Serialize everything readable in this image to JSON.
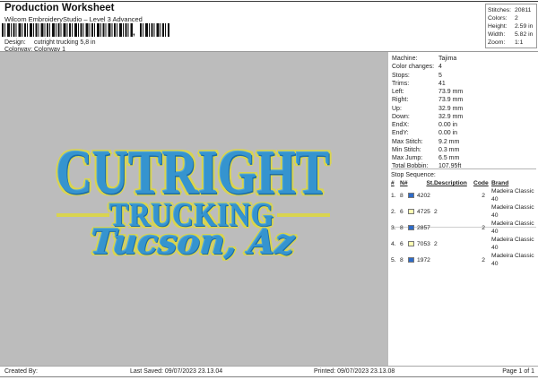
{
  "header": {
    "title": "Production Worksheet",
    "subtitle": "Wilcom EmbroideryStudio – Level 3 Advanced",
    "barcode_separator": ",",
    "design_label": "Design:",
    "design_value": "cutright trucking 5,8 in",
    "colorway_label": "Colorway:",
    "colorway_value": "Colorway 1"
  },
  "summary": {
    "rows": [
      {
        "label": "Stitches:",
        "value": "20811"
      },
      {
        "label": "Colors:",
        "value": "2"
      },
      {
        "label": "Height:",
        "value": "2.59 in"
      },
      {
        "label": "Width:",
        "value": "5.82 in"
      },
      {
        "label": "Zoom:",
        "value": "1:1"
      }
    ]
  },
  "machine_info": {
    "rows": [
      {
        "label": "Machine:",
        "value": "Tajima"
      },
      {
        "label": "Color changes:",
        "value": "4"
      },
      {
        "label": "Stops:",
        "value": "5"
      },
      {
        "label": "Trims:",
        "value": "41"
      },
      {
        "label": "Left:",
        "value": "73.9 mm"
      },
      {
        "label": "Right:",
        "value": "73.9 mm"
      },
      {
        "label": "Up:",
        "value": "32.9 mm"
      },
      {
        "label": "Down:",
        "value": "32.9 mm"
      },
      {
        "label": "EndX:",
        "value": "0.00 in"
      },
      {
        "label": "EndY:",
        "value": "0.00 in"
      },
      {
        "label": "Max Stitch:",
        "value": "9.2 mm"
      },
      {
        "label": "Min Stitch:",
        "value": "0.3 mm"
      },
      {
        "label": "Max Jump:",
        "value": "6.5 mm"
      },
      {
        "label": "Total Bobbin:",
        "value": "107.95ft"
      }
    ]
  },
  "stop_sequence": {
    "title": "Stop Sequence:",
    "headers": {
      "num": "#",
      "needle": "N#",
      "st": "St.",
      "description": "Description",
      "code": "Code",
      "brand": "Brand"
    },
    "rows": [
      {
        "num": "1.",
        "needle": "8",
        "swatch": "#2d6bc8",
        "st": "4202",
        "description": "",
        "code": "2",
        "brand": "Madeira Classic 40"
      },
      {
        "num": "2.",
        "needle": "6",
        "swatch": "#ffffb4",
        "st": "4725",
        "description": "2",
        "code": "",
        "brand": "Madeira Classic 40"
      },
      {
        "num": "3.",
        "needle": "8",
        "swatch": "#2d6bc8",
        "st": "2857",
        "description": "",
        "code": "2",
        "brand": "Madeira Classic 40"
      },
      {
        "num": "4.",
        "needle": "6",
        "swatch": "#ffffb4",
        "st": "7053",
        "description": "2",
        "code": "",
        "brand": "Madeira Classic 40"
      },
      {
        "num": "5.",
        "needle": "8",
        "swatch": "#2d6bc8",
        "st": "1972",
        "description": "",
        "code": "2",
        "brand": "Madeira Classic 40"
      }
    ]
  },
  "design_preview": {
    "line1": "CUTRIGHT",
    "line2": "TRUCKING",
    "line3": "Tucson, Az",
    "thread_blue": "#3594cf",
    "outline_yellow": "#d9d44f",
    "background_gray": "#bcbcbc"
  },
  "footer": {
    "created_by": "Created By:",
    "last_saved": "Last Saved: 09/07/2023 23.13.04",
    "printed": "Printed: 09/07/2023 23.13.08",
    "page": "Page 1 of 1"
  }
}
